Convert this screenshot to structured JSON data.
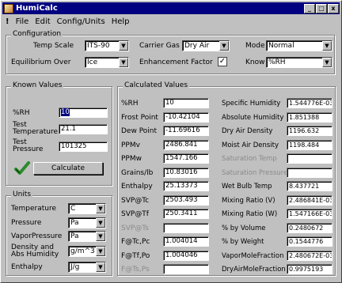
{
  "title": "HumiCalc",
  "title_buttons": [
    "_",
    "□",
    "x"
  ],
  "menu": {
    "bang": "!",
    "items": [
      "File",
      "Edit",
      "Config/Units",
      "Help"
    ]
  },
  "config": {
    "legend": "Configuration",
    "temp_scale_label": "Temp Scale",
    "temp_scale_value": "ITS-90",
    "carrier_gas_label": "Carrier Gas",
    "carrier_gas_value": "Dry Air",
    "mode_label": "Mode",
    "mode_value": "Normal",
    "equilibrium_label": "Equilibrium Over",
    "equilibrium_value": "Ice",
    "enhancement_label": "Enhancement Factor",
    "enhancement_checked": "✓",
    "know_label": "Know",
    "know_value": "%RH"
  },
  "known": {
    "legend": "Known Values",
    "rh_label": "%RH",
    "rh_value": "10",
    "temp_label_1": "Test",
    "temp_label_2": "Temperature",
    "temp_value": "21.1",
    "press_label_1": "Test",
    "press_label_2": "Pressure",
    "press_value": "101325",
    "calculate_label": "Calculate"
  },
  "units": {
    "legend": "Units",
    "rows": [
      {
        "label": "Temperature",
        "value": "C"
      },
      {
        "label": "Pressure",
        "value": "Pa"
      },
      {
        "label": "VaporPressure",
        "value": "Pa"
      },
      {
        "label": "Density and",
        "label2": "Abs Humidity",
        "value": "g/m^3"
      },
      {
        "label": "Enthalpy",
        "value": "J/g"
      }
    ]
  },
  "calc": {
    "legend": "Calculated Values",
    "left": [
      {
        "label": "%RH",
        "value": "10",
        "grey": false
      },
      {
        "label": "Frost Point",
        "value": "-10.42104",
        "grey": false
      },
      {
        "label": "Dew Point",
        "value": "-11.69616",
        "grey": false
      },
      {
        "label": "PPMv",
        "value": "2486.841",
        "grey": false
      },
      {
        "label": "PPMw",
        "value": "1547.166",
        "grey": false
      },
      {
        "label": "Grains/lb",
        "value": "10.83016",
        "grey": false
      },
      {
        "label": "Enthalpy",
        "value": "25.13373",
        "grey": false
      },
      {
        "label": "SVP@Tc",
        "value": "2503.493",
        "grey": false
      },
      {
        "label": "SVP@Tf",
        "value": "250.3411",
        "grey": false
      },
      {
        "label": "SVP@Ts",
        "value": "",
        "grey": true
      },
      {
        "label": "F@Tc,Pc",
        "value": "1.004014",
        "grey": false
      },
      {
        "label": "F@Tf,Po",
        "value": "1.004046",
        "grey": false
      },
      {
        "label": "F@Ts,Ps",
        "value": "",
        "grey": true
      }
    ],
    "right": [
      {
        "label": "Specific Humidity",
        "value": "1.544776E-03",
        "grey": false
      },
      {
        "label": "Absolute Humidity",
        "value": "1.851388",
        "grey": false
      },
      {
        "label": "Dry Air Density",
        "value": "1196.632",
        "grey": false
      },
      {
        "label": "Moist Air Density",
        "value": "1198.484",
        "grey": false
      },
      {
        "label": "Saturation Temp",
        "value": "",
        "grey": true
      },
      {
        "label": "Saturation Pressure",
        "value": "",
        "grey": true
      },
      {
        "label": "Wet Bulb Temp",
        "value": "8.437721",
        "grey": false
      },
      {
        "label": "Mixing Ratio (V)",
        "value": "2.486841E-03",
        "grey": false
      },
      {
        "label": "Mixing Ratio (W)",
        "value": "1.547166E-03",
        "grey": false
      },
      {
        "label": "% by Volume",
        "value": "0.2480672",
        "grey": false
      },
      {
        "label": "% by Weight",
        "value": "0.1544776",
        "grey": false
      },
      {
        "label": "VaporMoleFraction",
        "value": "2.480672E-03",
        "grey": false
      },
      {
        "label": "DryAirMoleFraction",
        "value": "0.9975193",
        "grey": false
      }
    ]
  },
  "colors": {
    "titlebar": "#000080",
    "face": "#c0c0c0",
    "selection": "#000080",
    "check_green": "#2a8a2a"
  }
}
